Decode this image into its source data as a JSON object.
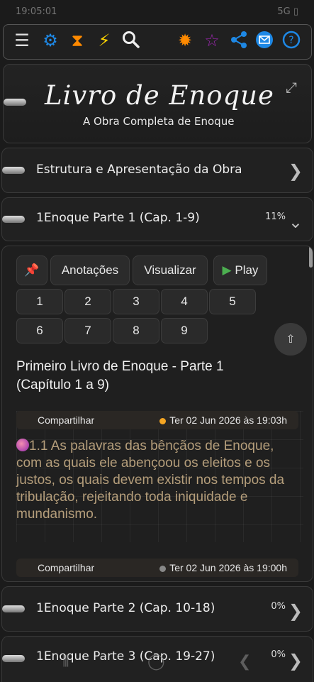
{
  "status_bar": {
    "time": "19:05:01",
    "icons": "5G ▯"
  },
  "toolbar": {
    "left_icons": [
      "menu-icon",
      "gear-icon",
      "hourglass-icon",
      "lightning-icon",
      "search-icon"
    ],
    "right_icons": [
      "sun-icon",
      "star-icon",
      "share-icon",
      "mail-icon",
      "help-icon"
    ],
    "colors": {
      "blue": "#1e88e5",
      "orange": "#ff8a00",
      "yellow": "#ffd400",
      "purple": "#9c27b0"
    }
  },
  "header": {
    "title": "Livro de Enoque",
    "subtitle": "A Obra Completa de Enoque"
  },
  "sections": [
    {
      "label": "Estrutura e Apresentação da Obra",
      "pct": ""
    },
    {
      "label": "1Enoque Parte 1 (Cap. 1-9)",
      "pct": "11%"
    },
    {
      "label": "1Enoque Parte 2 (Cap. 10-18)",
      "pct": "0%"
    },
    {
      "label": "1Enoque Parte 3 (Cap. 19-27)",
      "pct": "0%"
    }
  ],
  "content": {
    "buttons": {
      "notes": "Anotações",
      "view": "Visualizar",
      "play": "Play"
    },
    "chapters": [
      "1",
      "2",
      "3",
      "4",
      "5",
      "6",
      "7",
      "8",
      "9"
    ],
    "title": "Primeiro Livro de Enoque - Parte 1 (Capítulo 1 a 9)",
    "share_label": "Compartilhar",
    "meta_top_date": "Ter 02 Jun 2026 às 19:03h",
    "meta_bottom_date": "Ter 02 Jun 2026 às 19:00h",
    "verse": "1.1 As palavras das bênçãos de Enoque, com as quais ele abençoou os eleitos e os justos, os quais devem existir nos tempos da tribulação, rejeitando toda iniquidade e mundanismo.",
    "dot_colors": {
      "active": "#f5a623",
      "inactive": "#888888"
    }
  }
}
